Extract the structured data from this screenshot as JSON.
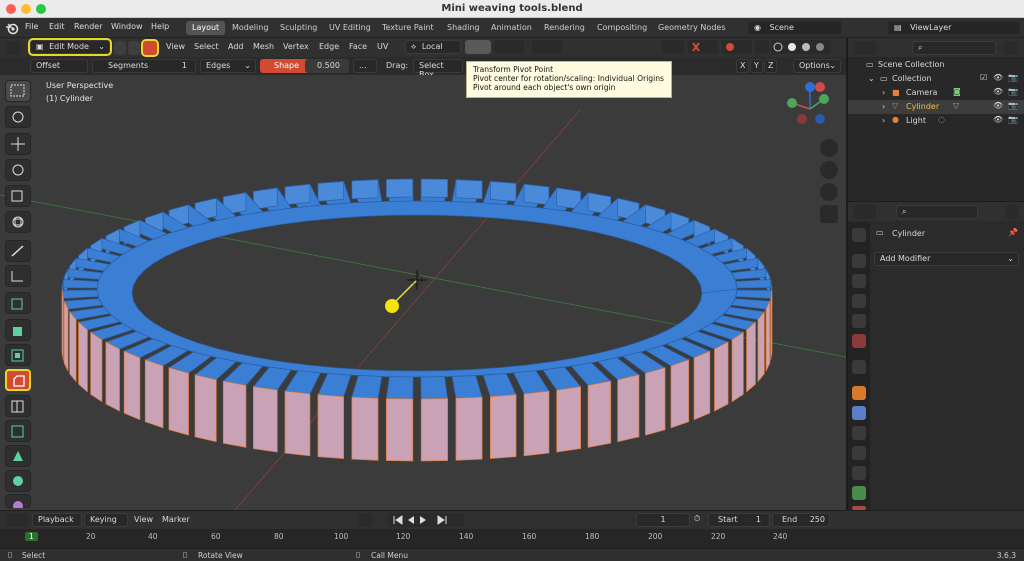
{
  "window": {
    "title": "Mini weaving tools.blend"
  },
  "topbar": {
    "menus": [
      "File",
      "Edit",
      "Render",
      "Window",
      "Help"
    ],
    "workspaces": [
      "Layout",
      "Modeling",
      "Sculpting",
      "UV Editing",
      "Texture Paint",
      "Shading",
      "Animation",
      "Rendering",
      "Compositing",
      "Geometry Nodes"
    ],
    "active_workspace": "Layout",
    "scene_label": "Scene",
    "viewlayer_label": "ViewLayer"
  },
  "viewport_header": {
    "mode": "Edit Mode",
    "menus": [
      "View",
      "Select",
      "Add",
      "Mesh",
      "Vertex",
      "Edge",
      "Face",
      "UV"
    ],
    "orientation": "Local"
  },
  "tool_settings": {
    "offset_label": "Offset",
    "segments_label": "Segments",
    "segments_value": "1",
    "edges_label": "Edges",
    "shape_label": "Shape",
    "shape_value": "0.500",
    "more_label": "...",
    "drag_label": "Drag:",
    "drag_value": "Select Box",
    "options_label": "Options",
    "axes": [
      "X",
      "Y",
      "Z"
    ]
  },
  "tooltip": {
    "title": "Transform Pivot Point",
    "line1": "Pivot center for rotation/scaling:  Individual Origins",
    "line2": "Pivot around each object's own origin"
  },
  "viewport": {
    "perspective": "User Perspective",
    "object": "(1) Cylinder"
  },
  "outliner": {
    "root": "Scene Collection",
    "collection": "Collection",
    "items": [
      "Camera",
      "Cylinder",
      "Light"
    ],
    "selected": "Cylinder"
  },
  "properties": {
    "object_name": "Cylinder",
    "add_modifier": "Add Modifier"
  },
  "timeline": {
    "playback": "Playback",
    "keying": "Keying",
    "view": "View",
    "marker": "Marker",
    "current_frame": "1",
    "start_label": "Start",
    "start_value": "1",
    "end_label": "End",
    "end_value": "250",
    "ticks": [
      "1",
      "20",
      "40",
      "60",
      "80",
      "100",
      "120",
      "140",
      "160",
      "180",
      "200",
      "220",
      "240"
    ]
  },
  "statusbar": {
    "select": "Select",
    "rotate_view": "Rotate View",
    "call_menu": "Call Menu",
    "version": "3.6.3"
  },
  "colors": {
    "accent_orange": "#d24a32",
    "highlight_yellow": "#e8d826",
    "mesh_blue": "#3b7fd4",
    "face_pink": "#c9a3b5"
  }
}
